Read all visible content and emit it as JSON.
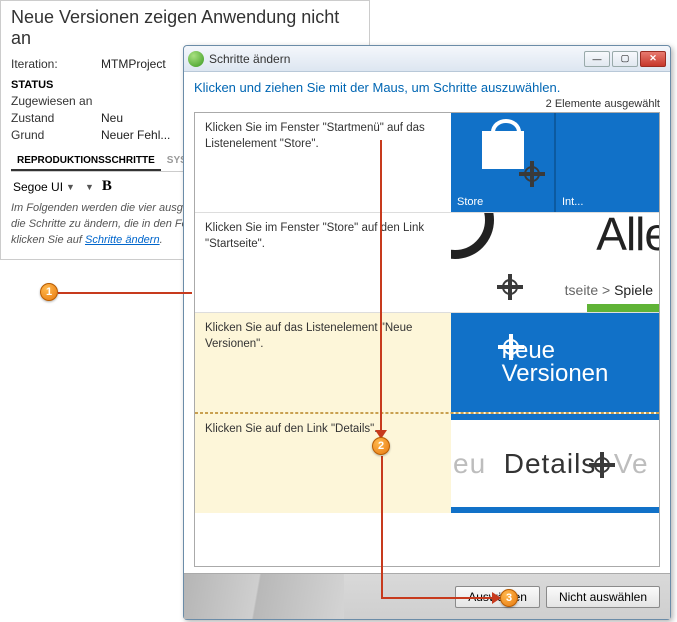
{
  "bg": {
    "title": "Neue Versionen zeigen Anwendung nicht an",
    "iteration_label": "Iteration:",
    "iteration_value": "MTMProject",
    "status_header": "STATUS",
    "assigned_label": "Zugewiesen an",
    "state_label": "Zustand",
    "state_value": "Neu",
    "reason_label": "Grund",
    "reason_value": "Neuer Fehl...",
    "tab_repro": "REPRODUKTIONSSCHRITTE",
    "tab_sys": "SYS..",
    "font_name": "Segoe UI",
    "help_text": "Im Folgenden werden die vier ausgeführten Schritte aufgeführt. Um die Schritte zu ändern, die in den Fehler einbezogen werden sollen, klicken Sie auf ",
    "help_link": "Schritte ändern",
    "help_text_end": "."
  },
  "dialog": {
    "title": "Schritte ändern",
    "instruction": "Klicken und ziehen Sie mit der Maus, um Schritte auszuwählen.",
    "selected_count": "2 Elemente ausgewählt",
    "btn_select": "Auswählen",
    "btn_deselect": "Nicht auswählen"
  },
  "steps": [
    {
      "text": "Klicken Sie im Fenster \"Startmenü\" auf das Listenelement \"Store\".",
      "selected": false,
      "thumb": {
        "tile1": "Store",
        "tile2": "Int..."
      }
    },
    {
      "text": "Klicken Sie im Fenster \"Store\" auf den Link \"Startseite\".",
      "selected": false,
      "thumb": {
        "headline": "Alle",
        "bcA": "tseite",
        "bcSep": ">",
        "bcB": "Spiele"
      }
    },
    {
      "text": "Klicken Sie auf das Listenelement \"Neue Versionen\".",
      "selected": true,
      "thumb": {
        "line1": "neue",
        "line2": "Versionen"
      }
    },
    {
      "text": "Klicken Sie auf den Link \"Details\".",
      "selected": true,
      "thumb": {
        "t1": "eu",
        "t2": "Details",
        "t3": "Ve"
      }
    }
  ],
  "callouts": {
    "c1": "1",
    "c2": "2",
    "c3": "3"
  }
}
